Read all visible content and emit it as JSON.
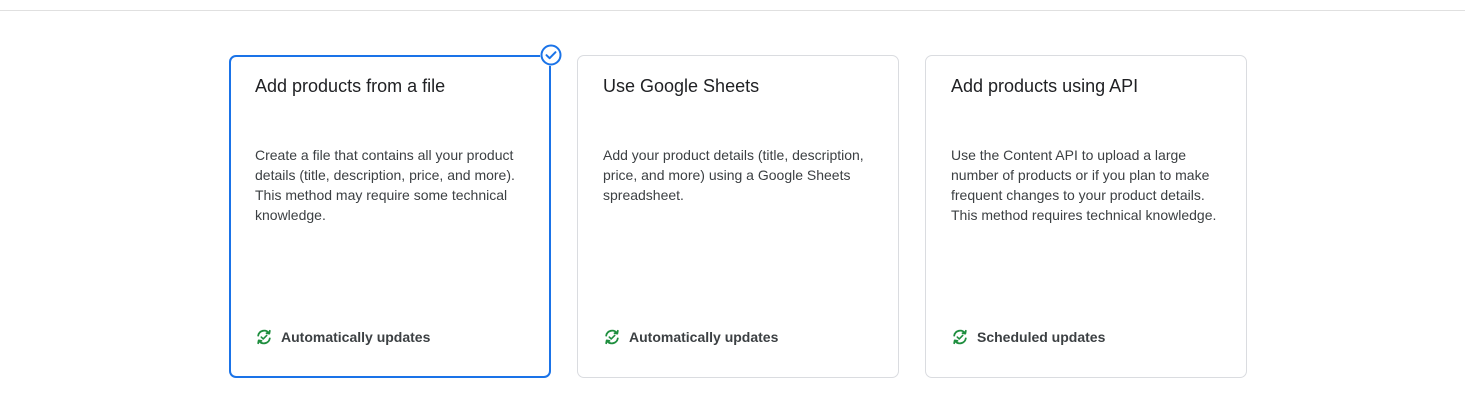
{
  "cards": [
    {
      "title": "Add products from a file",
      "description": "Create a file that contains all your product details (title, description, price, and more). This method may require some technical knowledge.",
      "footer_label": "Automatically updates",
      "footer_icon": "sync-icon",
      "selected": true
    },
    {
      "title": "Use Google Sheets",
      "description": "Add your product details (title, description, price, and more) using a Google Sheets spreadsheet.",
      "footer_label": "Automatically updates",
      "footer_icon": "sync-icon",
      "selected": false
    },
    {
      "title": "Add products using API",
      "description": "Use the Content API to upload a large number of products or if you plan to make frequent changes to your product details. This method requires technical knowledge.",
      "footer_label": "Scheduled updates",
      "footer_icon": "sync-icon",
      "selected": false
    }
  ],
  "colors": {
    "selected_border": "#1a73e8",
    "icon_green": "#1e8e3e",
    "check_blue": "#1a73e8"
  },
  "selected_indicator_icon": "check-circle-icon"
}
